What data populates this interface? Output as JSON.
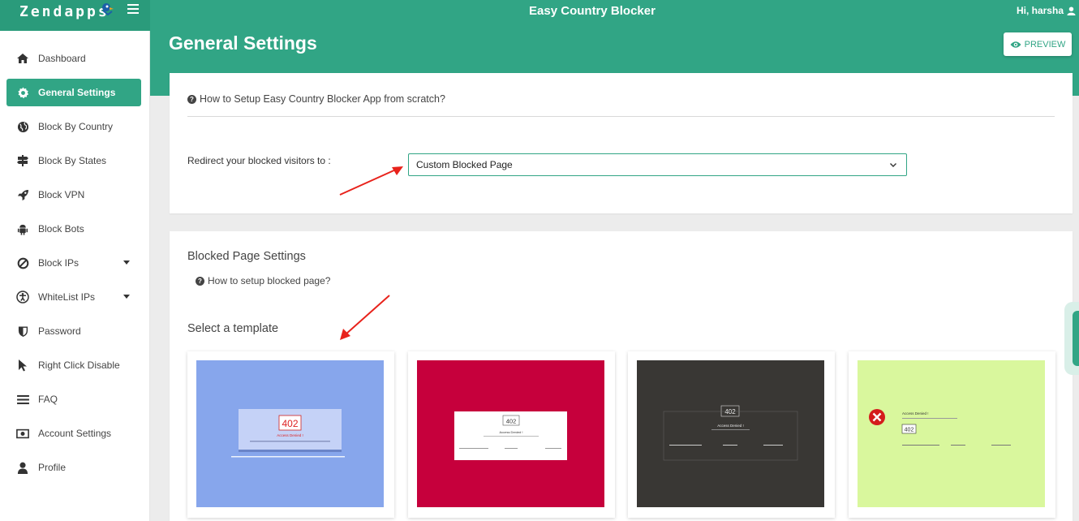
{
  "brand": {
    "logo_text": "Zendapps"
  },
  "header": {
    "app_title": "Easy Country Blocker",
    "user_greeting": "Hi, harsha"
  },
  "sidebar": {
    "items": [
      {
        "label": "Dashboard",
        "icon": "home-icon"
      },
      {
        "label": "General Settings",
        "icon": "gear-icon",
        "active": true
      },
      {
        "label": "Block By Country",
        "icon": "globe-icon"
      },
      {
        "label": "Block By States",
        "icon": "signpost-icon"
      },
      {
        "label": "Block VPN",
        "icon": "rocket-icon"
      },
      {
        "label": "Block Bots",
        "icon": "android-icon"
      },
      {
        "label": "Block IPs",
        "icon": "ban-icon",
        "has_dropdown": true
      },
      {
        "label": "WhiteList IPs",
        "icon": "accessibility-icon",
        "has_dropdown": true
      },
      {
        "label": "Password",
        "icon": "shield-icon"
      },
      {
        "label": "Right Click Disable",
        "icon": "cursor-icon"
      },
      {
        "label": "FAQ",
        "icon": "list-icon"
      },
      {
        "label": "Account Settings",
        "icon": "money-icon"
      },
      {
        "label": "Profile",
        "icon": "user-icon"
      }
    ]
  },
  "page": {
    "title": "General Settings",
    "preview_label": "PREVIEW"
  },
  "general": {
    "help_link": "How to Setup Easy Country Blocker App from scratch?",
    "redirect_label": "Redirect your blocked visitors to :",
    "redirect_value": "Custom Blocked Page"
  },
  "blocked_page": {
    "title": "Blocked Page Settings",
    "help_link": "How to setup blocked page?",
    "select_template_title": "Select a template",
    "templates": [
      {
        "bg": "#87a6ec",
        "code": "402",
        "heading": "Access Denied !"
      },
      {
        "bg": "#c6003c",
        "code": "402",
        "heading": "Access Denied !"
      },
      {
        "bg": "#393734",
        "code": "402",
        "heading": "Access Denied !"
      },
      {
        "bg": "#d9f79d",
        "code": "402",
        "heading": "Access Denied !"
      }
    ]
  },
  "colors": {
    "accent": "#31a585",
    "arrow": "#e8221b"
  }
}
